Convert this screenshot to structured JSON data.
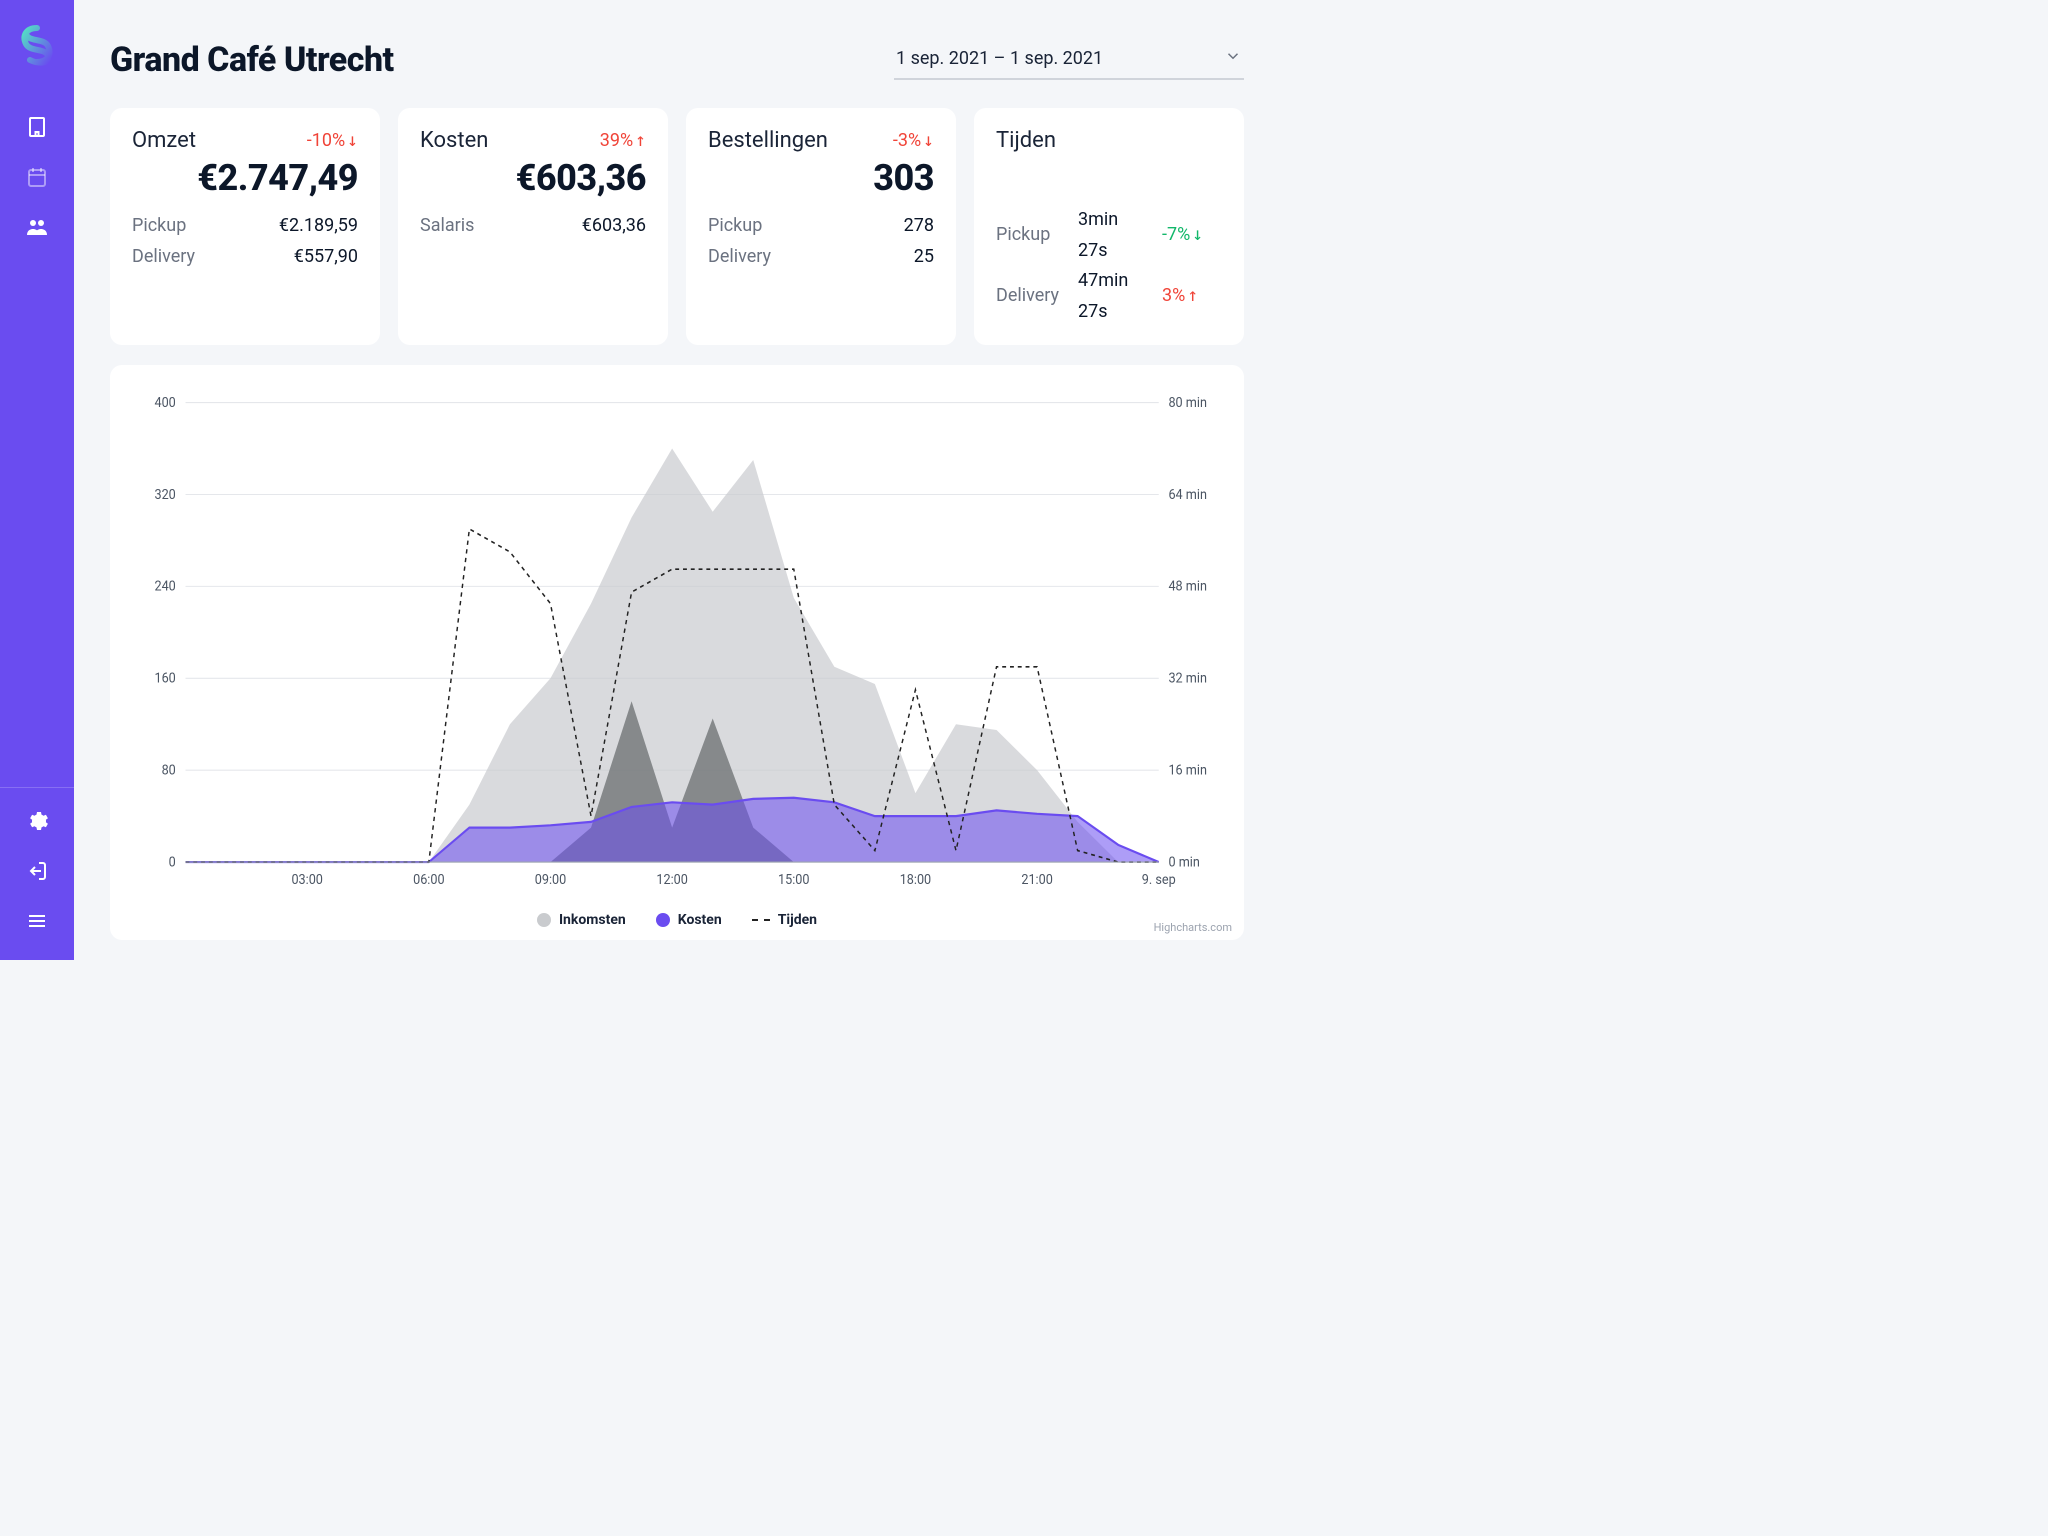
{
  "header": {
    "title": "Grand Café Utrecht",
    "date_range": "1 sep. 2021 – 1 sep. 2021"
  },
  "cards": {
    "omzet": {
      "title": "Omzet",
      "delta": "-10%",
      "delta_dir": "down",
      "value": "€2.747,49",
      "rows": [
        {
          "label": "Pickup",
          "value": "€2.189,59"
        },
        {
          "label": "Delivery",
          "value": "€557,90"
        }
      ]
    },
    "kosten": {
      "title": "Kosten",
      "delta": "39%",
      "delta_dir": "up",
      "value": "€603,36",
      "rows": [
        {
          "label": "Salaris",
          "value": "€603,36"
        }
      ]
    },
    "bestellingen": {
      "title": "Bestellingen",
      "delta": "-3%",
      "delta_dir": "down",
      "value": "303",
      "rows": [
        {
          "label": "Pickup",
          "value": "278"
        },
        {
          "label": "Delivery",
          "value": "25"
        }
      ]
    },
    "tijden": {
      "title": "Tijden",
      "rows": [
        {
          "label": "Pickup",
          "value": "3min 27s",
          "delta": "-7%",
          "delta_dir": "down",
          "delta_color": "green"
        },
        {
          "label": "Delivery",
          "value": "47min 27s",
          "delta": "3%",
          "delta_dir": "up",
          "delta_color": "red"
        }
      ]
    }
  },
  "chart": {
    "legend": {
      "inkomsten": "Inkomsten",
      "kosten": "Kosten",
      "tijden": "Tijden"
    },
    "y_left_ticks": [
      "0",
      "80",
      "160",
      "240",
      "320",
      "400"
    ],
    "y_right_ticks": [
      "0 min",
      "16 min",
      "32 min",
      "48 min",
      "64 min",
      "80 min"
    ],
    "x_ticks": [
      "03:00",
      "06:00",
      "09:00",
      "12:00",
      "15:00",
      "18:00",
      "21:00",
      "9. sep"
    ],
    "credits": "Highcharts.com"
  },
  "chart_data": {
    "type": "area",
    "x": [
      "00:00",
      "01:00",
      "02:00",
      "03:00",
      "04:00",
      "05:00",
      "06:00",
      "07:00",
      "08:00",
      "09:00",
      "10:00",
      "11:00",
      "12:00",
      "13:00",
      "14:00",
      "15:00",
      "16:00",
      "17:00",
      "18:00",
      "19:00",
      "20:00",
      "21:00",
      "22:00",
      "23:00",
      "9. sep"
    ],
    "ylim_left": [
      0,
      400
    ],
    "ylim_right_minutes": [
      0,
      80
    ],
    "series": [
      {
        "name": "Inkomsten",
        "axis": "left",
        "style": "area-grey-light",
        "values": [
          0,
          0,
          0,
          0,
          0,
          0,
          0,
          50,
          120,
          160,
          225,
          300,
          360,
          305,
          350,
          230,
          170,
          155,
          60,
          120,
          115,
          80,
          35,
          0,
          0
        ]
      },
      {
        "name": "Inkomsten peak",
        "axis": "left",
        "style": "area-grey-dark",
        "values": [
          0,
          0,
          0,
          0,
          0,
          0,
          0,
          0,
          0,
          0,
          30,
          140,
          30,
          125,
          30,
          0,
          0,
          0,
          0,
          0,
          0,
          0,
          0,
          0,
          0
        ]
      },
      {
        "name": "Kosten",
        "axis": "left",
        "style": "area-purple",
        "values": [
          0,
          0,
          0,
          0,
          0,
          0,
          0,
          30,
          30,
          32,
          35,
          48,
          52,
          50,
          55,
          56,
          52,
          40,
          40,
          40,
          45,
          42,
          40,
          15,
          0
        ]
      },
      {
        "name": "Tijden",
        "axis": "right",
        "unit": "minutes",
        "style": "line-dash",
        "values": [
          0,
          0,
          0,
          0,
          0,
          0,
          0,
          58,
          54,
          45,
          8,
          47,
          51,
          51,
          51,
          51,
          10,
          2,
          30,
          2,
          34,
          34,
          2,
          0,
          0
        ]
      }
    ]
  }
}
